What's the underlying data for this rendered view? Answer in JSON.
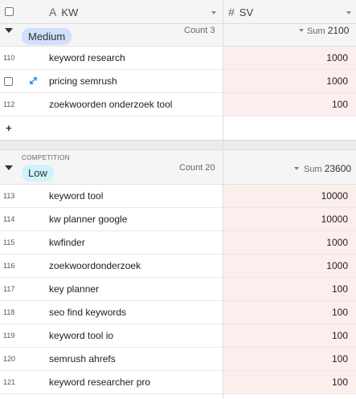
{
  "header": {
    "kw_icon": "text-field-icon",
    "kw_label": "KW",
    "sv_icon": "number-field-icon",
    "sv_label": "SV"
  },
  "colors": {
    "medium_pill": "#cfe0fc",
    "low_pill": "#d1f2fb",
    "sv_cell_bg": "#fdeeee"
  },
  "groups": [
    {
      "pill": "Medium",
      "count_label": "Count",
      "count": "3",
      "sum_label": "Sum",
      "sum": "2100",
      "rows": [
        {
          "num": "110",
          "kw": "keyword research",
          "sv": "1000"
        },
        {
          "num": "",
          "kw": "pricing semrush",
          "sv": "1000"
        },
        {
          "num": "112",
          "kw": "zoekwoorden onderzoek tool",
          "sv": "100"
        }
      ],
      "add_label": "+"
    },
    {
      "field_label": "COMPETITION",
      "pill": "Low",
      "count_label": "Count",
      "count": "20",
      "sum_label": "Sum",
      "sum": "23600",
      "rows": [
        {
          "num": "113",
          "kw": "keyword tool",
          "sv": "10000"
        },
        {
          "num": "114",
          "kw": "kw planner google",
          "sv": "10000"
        },
        {
          "num": "115",
          "kw": "kwfinder",
          "sv": "1000"
        },
        {
          "num": "116",
          "kw": "zoekwoordonderzoek",
          "sv": "1000"
        },
        {
          "num": "117",
          "kw": "key planner",
          "sv": "100"
        },
        {
          "num": "118",
          "kw": "seo find keywords",
          "sv": "100"
        },
        {
          "num": "119",
          "kw": "keyword tool io",
          "sv": "100"
        },
        {
          "num": "120",
          "kw": "semrush ahrefs",
          "sv": "100"
        },
        {
          "num": "121",
          "kw": "keyword researcher pro",
          "sv": "100"
        }
      ]
    }
  ]
}
